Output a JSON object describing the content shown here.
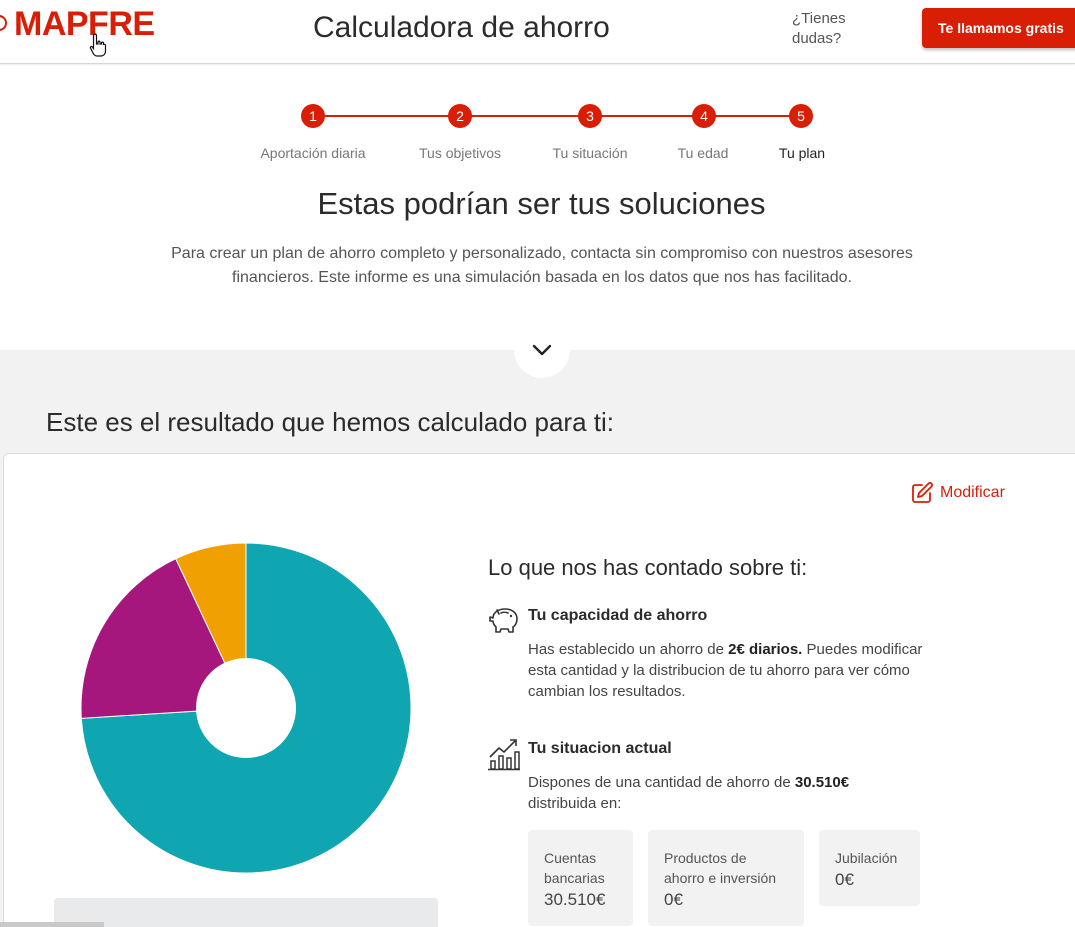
{
  "header": {
    "logo": "MAPFRE",
    "title": "Calculadora de ahorro",
    "help": "¿Tienes dudas?",
    "call_button": "Te llamamos gratis"
  },
  "stepper": {
    "steps": [
      {
        "number": "1",
        "label": "Aportación diaria"
      },
      {
        "number": "2",
        "label": "Tus objetivos"
      },
      {
        "number": "3",
        "label": "Tu situación"
      },
      {
        "number": "4",
        "label": "Tu edad"
      },
      {
        "number": "5",
        "label": "Tu plan"
      }
    ],
    "active_step": 5
  },
  "solutions": {
    "title": "Estas podrían ser tus soluciones",
    "description": "Para crear un plan de ahorro completo y personalizado, contacta sin compromiso con nuestros asesores financieros. Este informe es una simulación basada en los datos que nos has facilitado."
  },
  "result": {
    "title": "Este es el resultado que hemos calculado para ti:",
    "modify_label": "Modificar"
  },
  "chart_data": {
    "type": "pie",
    "donut": true,
    "slices": [
      {
        "color": "#0fa5b1",
        "fraction": 0.74
      },
      {
        "color": "#a5177d",
        "fraction": 0.19
      },
      {
        "color": "#f0a000",
        "fraction": 0.07
      }
    ]
  },
  "about": {
    "title": "Lo que nos has contado sobre ti:",
    "capacity": {
      "title": "Tu capacidad de ahorro",
      "text_before": "Has establecido un ahorro de ",
      "bold": "2€ diarios.",
      "text_after": " Puedes modificar esta cantidad y la distribucion de tu ahorro para ver cómo cambian los resultados."
    },
    "situation": {
      "title": "Tu situacion actual",
      "text_before": "Dispones de una cantidad de ahorro de ",
      "bold": "30.510€",
      "text_after": " distribuida en:"
    },
    "tiles": [
      {
        "label": "Cuentas bancarias",
        "value": "30.510€"
      },
      {
        "label": "Productos de ahorro e inversión",
        "value": "0€"
      },
      {
        "label": "Jubilación",
        "value": "0€"
      }
    ]
  },
  "colors": {
    "brand_red": "#d81e05",
    "teal": "#0fa5b1",
    "purple": "#a5177d",
    "orange": "#f0a000"
  }
}
